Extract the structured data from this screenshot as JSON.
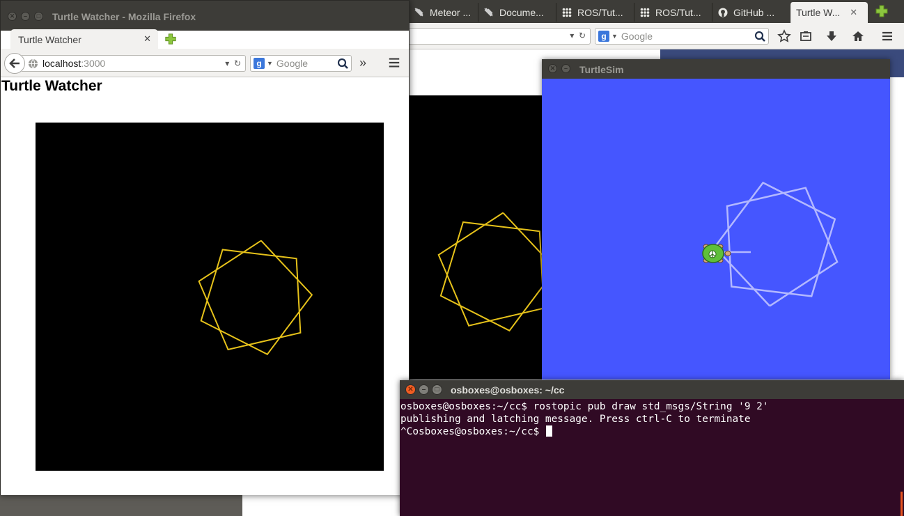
{
  "bg_browser": {
    "tabs": [
      {
        "label": "Meteor ...",
        "icon": "meteor-icon"
      },
      {
        "label": "Docume...",
        "icon": "meteor-icon"
      },
      {
        "label": "ROS/Tut...",
        "icon": "ros-icon"
      },
      {
        "label": "ROS/Tut...",
        "icon": "ros-icon"
      },
      {
        "label": "GitHub ...",
        "icon": "github-icon"
      },
      {
        "label": "Turtle W...",
        "icon": "none"
      }
    ],
    "search_placeholder": "Google"
  },
  "fg_browser": {
    "window_title": "Turtle Watcher - Mozilla Firefox",
    "tab_label": "Turtle Watcher",
    "url_host": "localhost",
    "url_port": ":3000",
    "search_placeholder": "Google",
    "page_heading": "Turtle Watcher",
    "star_color": "#e6c21a"
  },
  "turtlesim": {
    "window_title": "TurtleSim",
    "background": "#4556ff",
    "line_color": "#b3b8ff"
  },
  "terminal": {
    "window_title": "osboxes@osboxes: ~/cc",
    "lines": [
      "osboxes@osboxes:~/cc$ rostopic pub draw std_msgs/String '9 2'",
      "publishing and latching message. Press ctrl-C to terminate",
      "^Cosboxes@osboxes:~/cc$ "
    ]
  }
}
